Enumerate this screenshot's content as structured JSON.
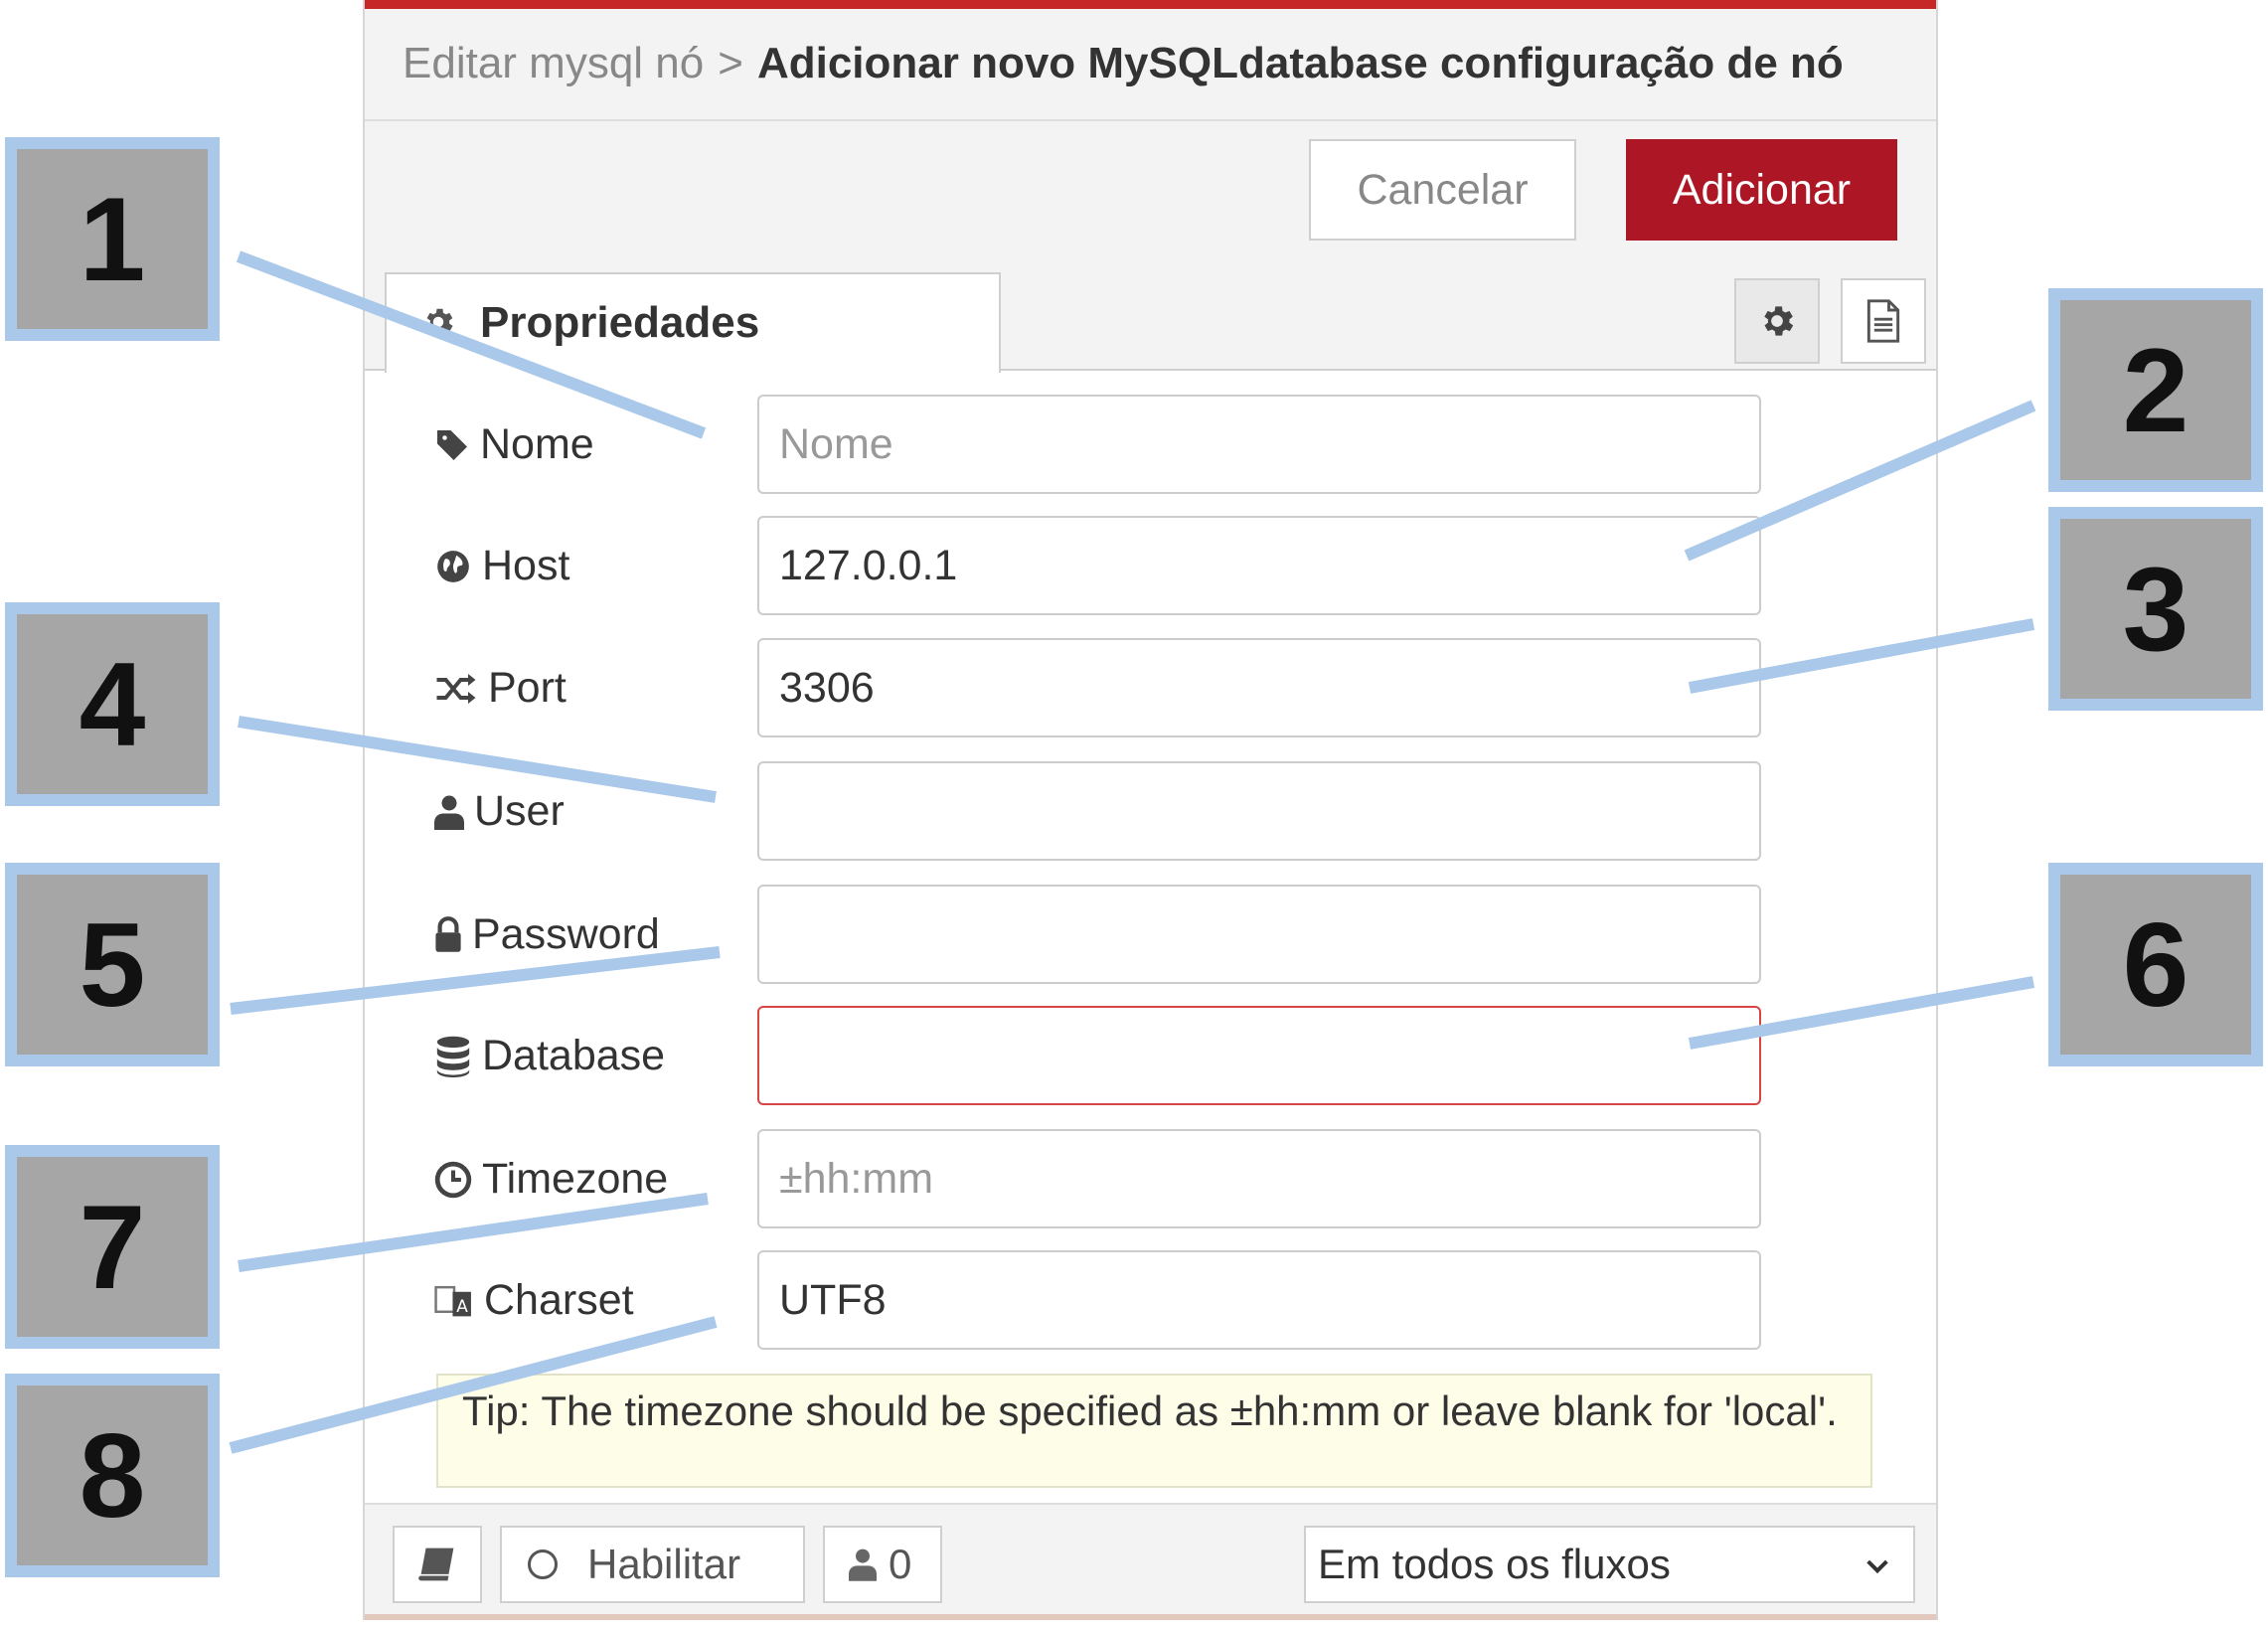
{
  "header": {
    "crumb": "Editar mysql nó",
    "separator": ">",
    "title": "Adicionar novo MySQLdatabase configuração de nó"
  },
  "toolbar": {
    "cancel_label": "Cancelar",
    "add_label": "Adicionar"
  },
  "tabs": {
    "properties_label": "Propriedades",
    "settings_icon": "gear-icon",
    "description_icon": "document-icon"
  },
  "fields": {
    "name": {
      "label": "Nome",
      "icon": "tag-icon",
      "value": "",
      "placeholder": "Nome"
    },
    "host": {
      "label": "Host",
      "icon": "globe-icon",
      "value": "127.0.0.1",
      "placeholder": ""
    },
    "port": {
      "label": "Port",
      "icon": "random-icon",
      "value": "3306",
      "placeholder": ""
    },
    "user": {
      "label": "User",
      "icon": "user-icon",
      "value": "",
      "placeholder": ""
    },
    "password": {
      "label": "Password",
      "icon": "lock-icon",
      "value": "",
      "placeholder": ""
    },
    "database": {
      "label": "Database",
      "icon": "database-icon",
      "value": "",
      "placeholder": ""
    },
    "timezone": {
      "label": "Timezone",
      "icon": "clock-icon",
      "value": "",
      "placeholder": "±hh:mm"
    },
    "charset": {
      "label": "Charset",
      "icon": "language-icon",
      "value": "UTF8",
      "placeholder": ""
    }
  },
  "tip": "Tip: The timezone should be specified as ±hh:mm or leave blank for 'local'.",
  "footer": {
    "enable_label": "Habilitar",
    "users_count": "0",
    "scope_value": "Em todos os fluxos"
  },
  "colors": {
    "accent": "#ad1625",
    "callout_fill": "#a6a6a6",
    "callout_border": "#a9c8ea",
    "invalid_border": "#d84545"
  },
  "callouts": [
    "1",
    "2",
    "3",
    "4",
    "5",
    "6",
    "7",
    "8"
  ]
}
